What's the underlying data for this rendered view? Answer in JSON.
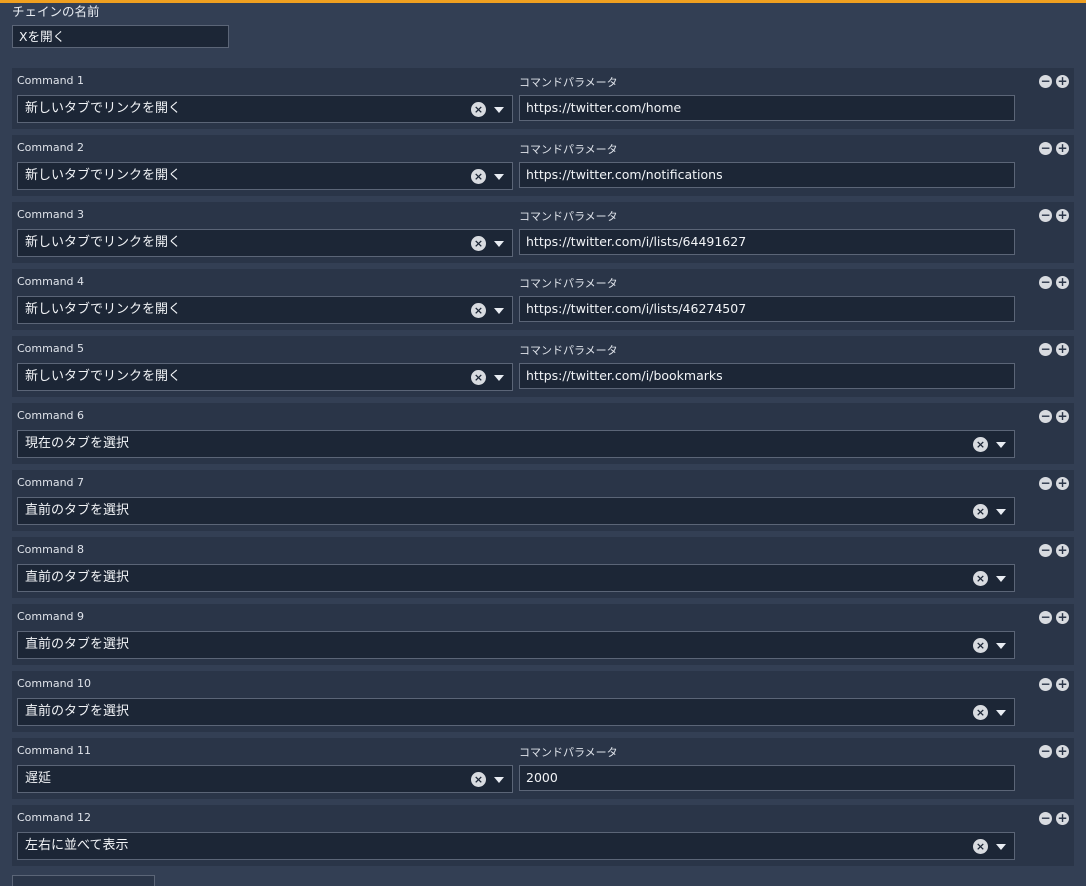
{
  "colors": {
    "accent": "#f0a020",
    "background": "#333f54",
    "row": "#2a3548",
    "field": "#1c2636"
  },
  "chain": {
    "name_label": "チェインの名前",
    "name_value": "Xを開く"
  },
  "param_label": "コマンドパラメータ",
  "icons": {
    "clear": "circle-x-icon",
    "dropdown": "caret-down-icon",
    "remove": "circle-minus-icon",
    "add": "circle-plus-icon"
  },
  "commands": [
    {
      "label": "Command 1",
      "action": "新しいタブでリンクを開く",
      "param": "https://twitter.com/home"
    },
    {
      "label": "Command 2",
      "action": "新しいタブでリンクを開く",
      "param": "https://twitter.com/notifications"
    },
    {
      "label": "Command 3",
      "action": "新しいタブでリンクを開く",
      "param": "https://twitter.com/i/lists/64491627"
    },
    {
      "label": "Command 4",
      "action": "新しいタブでリンクを開く",
      "param": "https://twitter.com/i/lists/46274507"
    },
    {
      "label": "Command 5",
      "action": "新しいタブでリンクを開く",
      "param": "https://twitter.com/i/bookmarks"
    },
    {
      "label": "Command 6",
      "action": "現在のタブを選択"
    },
    {
      "label": "Command 7",
      "action": "直前のタブを選択"
    },
    {
      "label": "Command 8",
      "action": "直前のタブを選択"
    },
    {
      "label": "Command 9",
      "action": "直前のタブを選択"
    },
    {
      "label": "Command 10",
      "action": "直前のタブを選択"
    },
    {
      "label": "Command 11",
      "action": "遅延",
      "param": "2000"
    },
    {
      "label": "Command 12",
      "action": "左右に並べて表示"
    }
  ]
}
